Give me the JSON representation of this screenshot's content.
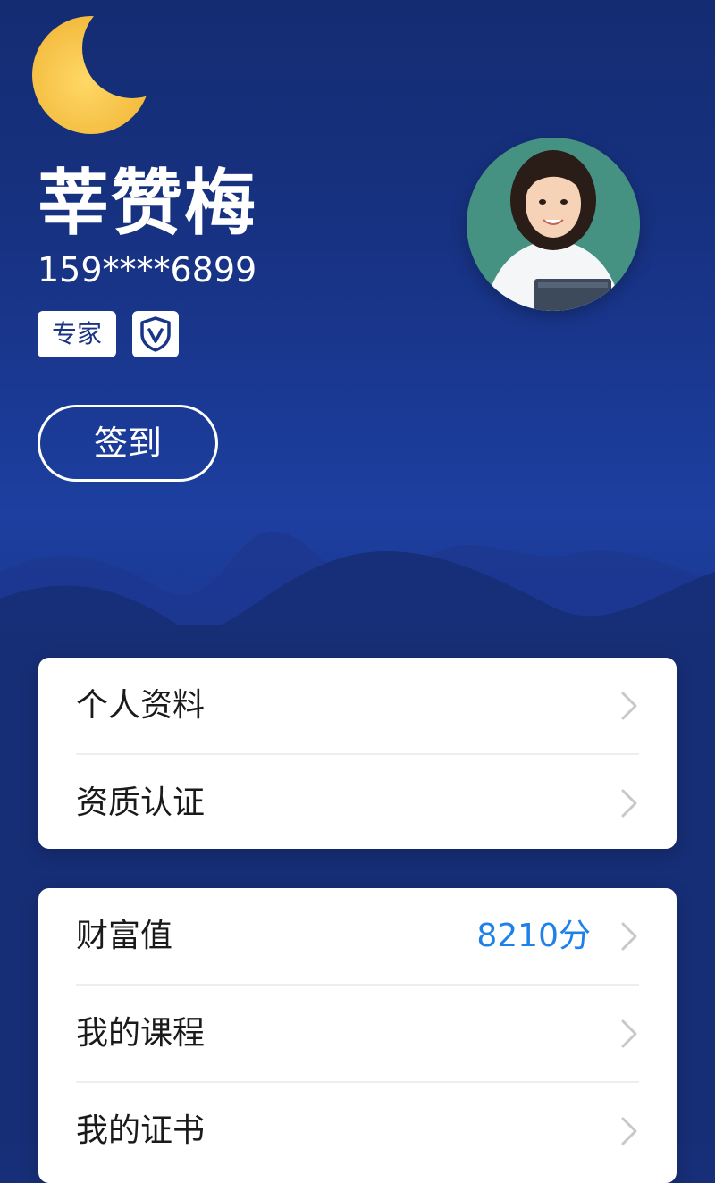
{
  "profile": {
    "name": "莘赞梅",
    "phone": "159****6899",
    "badge_expert": "专家",
    "badge_verified_icon": "shield-check-icon",
    "checkin_label": "签到"
  },
  "menu_group_1": [
    {
      "label": "个人资料"
    },
    {
      "label": "资质认证"
    }
  ],
  "menu_group_2": [
    {
      "label": "财富值",
      "value": "8210分"
    },
    {
      "label": "我的课程"
    },
    {
      "label": "我的证书"
    }
  ],
  "colors": {
    "background": "#172f78",
    "accent_value": "#1e80e8",
    "moon": "#f7c94a",
    "card": "#ffffff"
  }
}
